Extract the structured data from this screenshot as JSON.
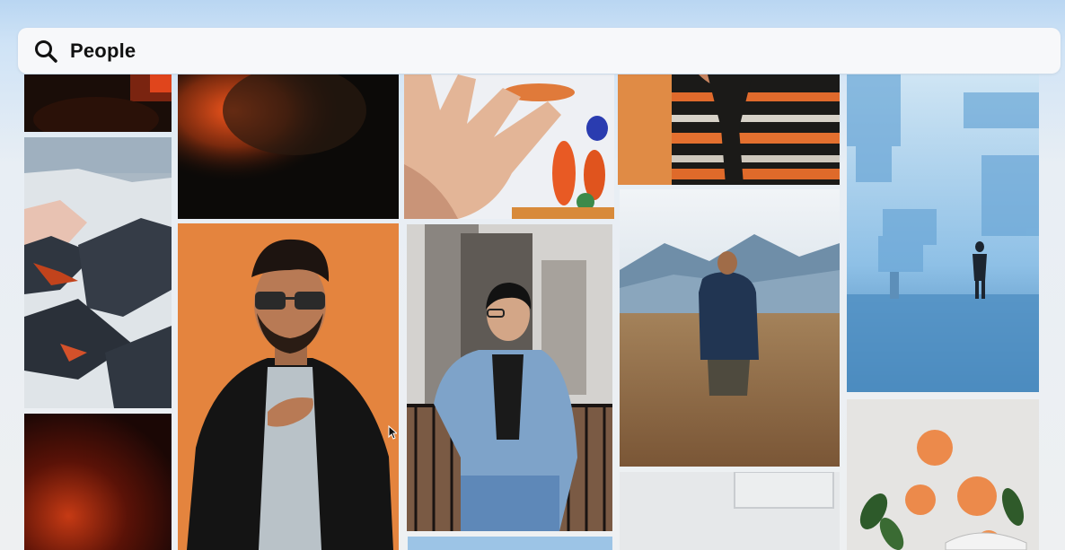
{
  "search": {
    "query": "People",
    "icon": "search-icon"
  },
  "gallery": {
    "tiles": [
      {
        "name": "photo-dark-orange-top"
      },
      {
        "name": "photo-snowy-mountains"
      },
      {
        "name": "photo-dark-red-glow"
      },
      {
        "name": "photo-dark-face-orange"
      },
      {
        "name": "photo-man-sunglasses-orange"
      },
      {
        "name": "photo-hand-paint"
      },
      {
        "name": "photo-man-denim-jacket"
      },
      {
        "name": "photo-patterned-shirt"
      },
      {
        "name": "photo-man-field-mountains"
      },
      {
        "name": "photo-wall-frame"
      },
      {
        "name": "photo-glass-stairs-figure"
      },
      {
        "name": "photo-oranges-leaves"
      }
    ]
  }
}
